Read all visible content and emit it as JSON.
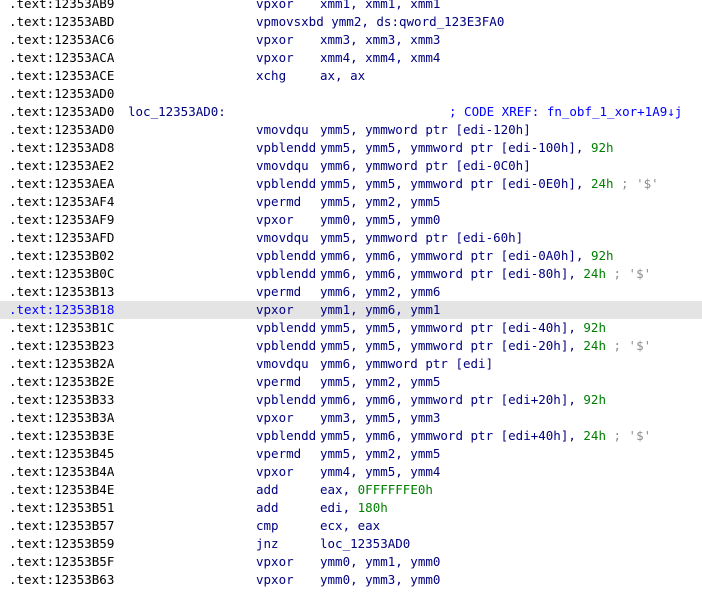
{
  "listing": {
    "rows": [
      {
        "addr": ".text:12353AB9",
        "mnem": "vpxor",
        "ops": "xmm1, xmm1, xmm1"
      },
      {
        "addr": ".text:12353ABD",
        "mnem": "vpmovsxbd ymm2, ds:qword_123E3FA0",
        "ops": ""
      },
      {
        "addr": ".text:12353AC6",
        "mnem": "vpxor",
        "ops": "xmm3, xmm3, xmm3"
      },
      {
        "addr": ".text:12353ACA",
        "mnem": "vpxor",
        "ops": "xmm4, xmm4, xmm4"
      },
      {
        "addr": ".text:12353ACE",
        "mnem": "xchg",
        "ops": "ax, ax"
      },
      {
        "addr": ".text:12353AD0"
      },
      {
        "addr": ".text:12353AD0",
        "label": "loc_12353AD0:",
        "xref": "; CODE XREF: fn_obf_1_xor+1A9↓j"
      },
      {
        "addr": ".text:12353AD0",
        "mnem": "vmovdqu",
        "ops": "ymm5, ymmword ptr [edi-120h]"
      },
      {
        "addr": ".text:12353AD8",
        "mnem": "vpblendd",
        "ops": "ymm5, ymm5, ymmword ptr [edi-100h], ",
        "num": "92h"
      },
      {
        "addr": ".text:12353AE2",
        "mnem": "vmovdqu",
        "ops": "ymm6, ymmword ptr [edi-0C0h]"
      },
      {
        "addr": ".text:12353AEA",
        "mnem": "vpblendd",
        "ops": "ymm5, ymm5, ymmword ptr [edi-0E0h], ",
        "num": "24h",
        "comment": " ; '$'"
      },
      {
        "addr": ".text:12353AF4",
        "mnem": "vpermd",
        "ops": "ymm5, ymm2, ymm5"
      },
      {
        "addr": ".text:12353AF9",
        "mnem": "vpxor",
        "ops": "ymm0, ymm5, ymm0"
      },
      {
        "addr": ".text:12353AFD",
        "mnem": "vmovdqu",
        "ops": "ymm5, ymmword ptr [edi-60h]"
      },
      {
        "addr": ".text:12353B02",
        "mnem": "vpblendd",
        "ops": "ymm6, ymm6, ymmword ptr [edi-0A0h], ",
        "num": "92h"
      },
      {
        "addr": ".text:12353B0C",
        "mnem": "vpblendd",
        "ops": "ymm6, ymm6, ymmword ptr [edi-80h], ",
        "num": "24h",
        "comment": " ; '$'"
      },
      {
        "addr": ".text:12353B13",
        "mnem": "vpermd",
        "ops": "ymm6, ymm2, ymm6"
      },
      {
        "addr": ".text:12353B18",
        "mnem": "vpxor",
        "ops": "ymm1, ymm6, ymm1",
        "selected": true
      },
      {
        "addr": ".text:12353B1C",
        "mnem": "vpblendd",
        "ops": "ymm5, ymm5, ymmword ptr [edi-40h], ",
        "num": "92h"
      },
      {
        "addr": ".text:12353B23",
        "mnem": "vpblendd",
        "ops": "ymm5, ymm5, ymmword ptr [edi-20h], ",
        "num": "24h",
        "comment": " ; '$'"
      },
      {
        "addr": ".text:12353B2A",
        "mnem": "vmovdqu",
        "ops": "ymm6, ymmword ptr [edi]"
      },
      {
        "addr": ".text:12353B2E",
        "mnem": "vpermd",
        "ops": "ymm5, ymm2, ymm5"
      },
      {
        "addr": ".text:12353B33",
        "mnem": "vpblendd",
        "ops": "ymm6, ymm6, ymmword ptr [edi+20h], ",
        "num": "92h"
      },
      {
        "addr": ".text:12353B3A",
        "mnem": "vpxor",
        "ops": "ymm3, ymm5, ymm3"
      },
      {
        "addr": ".text:12353B3E",
        "mnem": "vpblendd",
        "ops": "ymm5, ymm6, ymmword ptr [edi+40h], ",
        "num": "24h",
        "comment": " ; '$'"
      },
      {
        "addr": ".text:12353B45",
        "mnem": "vpermd",
        "ops": "ymm5, ymm2, ymm5"
      },
      {
        "addr": ".text:12353B4A",
        "mnem": "vpxor",
        "ops": "ymm4, ymm5, ymm4"
      },
      {
        "addr": ".text:12353B4E",
        "mnem": "add",
        "ops": "eax, ",
        "num": "0FFFFFFE0h"
      },
      {
        "addr": ".text:12353B51",
        "mnem": "add",
        "ops": "edi, ",
        "num": "180h"
      },
      {
        "addr": ".text:12353B57",
        "mnem": "cmp",
        "ops": "ecx, eax"
      },
      {
        "addr": ".text:12353B59",
        "mnem": "jnz",
        "ops": "loc_12353AD0"
      },
      {
        "addr": ".text:12353B5F",
        "mnem": "vpxor",
        "ops": "ymm0, ymm1, ymm0"
      },
      {
        "addr": ".text:12353B63",
        "mnem": "vpxor",
        "ops": "ymm0, ymm3, ymm0"
      }
    ]
  }
}
